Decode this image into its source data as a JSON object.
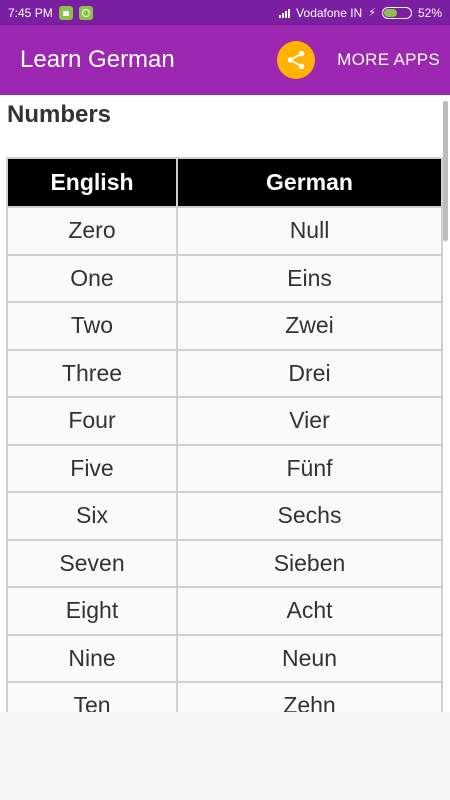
{
  "status_bar": {
    "time": "7:45 PM",
    "carrier": "Vodafone IN",
    "battery": "52%",
    "battery_level": 0.52
  },
  "app_bar": {
    "title": "Learn German",
    "share_icon": "share-icon",
    "more_apps_label": "MORE APPS"
  },
  "section": {
    "title": "Numbers"
  },
  "table": {
    "headers": [
      "English",
      "German"
    ],
    "rows": [
      [
        "Zero",
        "Null"
      ],
      [
        "One",
        "Eins"
      ],
      [
        "Two",
        "Zwei"
      ],
      [
        "Three",
        "Drei"
      ],
      [
        "Four",
        "Vier"
      ],
      [
        "Five",
        "Fünf"
      ],
      [
        "Six",
        "Sechs"
      ],
      [
        "Seven",
        "Sieben"
      ],
      [
        "Eight",
        "Acht"
      ],
      [
        "Nine",
        "Neun"
      ],
      [
        "Ten",
        "Zehn"
      ]
    ]
  },
  "colors": {
    "status_bar": "#7b1fa2",
    "app_bar": "#9c27b0",
    "share_button": "#ffb300",
    "header_bg": "#000000"
  }
}
